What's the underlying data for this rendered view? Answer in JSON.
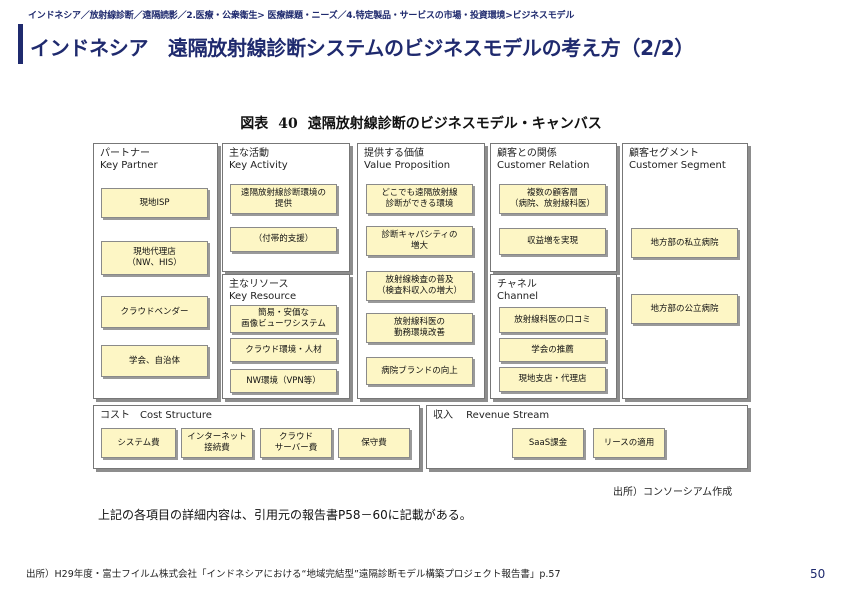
{
  "header": {
    "breadcrumb": "インドネシア／放射線診断／遠隔読影／2.医療・公衆衛生> 医療課題・ニーズ／4.特定製品・サービスの市場・投資環境>ビジネスモデル",
    "title": "インドネシア　遠隔放射線診断システムのビジネスモデルの考え方（2/2）"
  },
  "figure": {
    "label": "図表",
    "number": "40",
    "title": "遠隔放射線診断のビジネスモデル・キャンバス"
  },
  "canvas": {
    "key_partner": {
      "label": "パートナー\nKey Partner",
      "items": [
        "現地ISP",
        "現地代理店\n（NW、HIS）",
        "クラウドベンダー",
        "学会、自治体"
      ]
    },
    "key_activity": {
      "label": "主な活動\nKey Activity",
      "items": [
        "遠隔放射線診断環境の\n提供",
        "（付帯的支援）"
      ]
    },
    "key_resource": {
      "label": "主なリソース\nKey Resource",
      "items": [
        "簡易・安価な\n画像ビューワシステム",
        "クラウド環境・人材",
        "NW環境（VPN等）"
      ]
    },
    "value_proposition": {
      "label": "提供する価値\nValue Proposition",
      "items": [
        "どこでも遠隔放射線\n診断ができる環境",
        "診断キャパシティの\n増大",
        "放射線検査の普及\n（検査料収入の増大）",
        "放射線科医の\n勤務環境改善",
        "病院ブランドの向上"
      ]
    },
    "customer_relation": {
      "label": "顧客との関係\nCustomer Relation",
      "items": [
        "複数の顧客層\n（病院、放射線科医）",
        "収益増を実現"
      ]
    },
    "channel": {
      "label": "チャネル\nChannel",
      "items": [
        "放射線科医の口コミ",
        "学会の推薦",
        "現地支店・代理店"
      ]
    },
    "customer_segment": {
      "label": "顧客セグメント\nCustomer Segment",
      "items": [
        "地方部の私立病院",
        "地方部の公立病院"
      ]
    },
    "cost_structure": {
      "label": "コスト　Cost Structure",
      "items": [
        "システム費",
        "インターネット\n接続費",
        "クラウド\nサーバー費",
        "保守費"
      ]
    },
    "revenue_stream": {
      "label": "収入　 Revenue Stream",
      "items": [
        "SaaS課金",
        "リースの適用"
      ]
    }
  },
  "source_right": "出所）コンソーシアム作成",
  "summary": "上記の各項目の詳細内容は、引用元の報告書P58－60に記載がある。",
  "footer_source": "出所）H29年度・富士フイルム株式会社「インドネシアにおける“地域完結型”遠隔診断モデル構築プロジェクト報告書」p.57",
  "page_number": "50"
}
